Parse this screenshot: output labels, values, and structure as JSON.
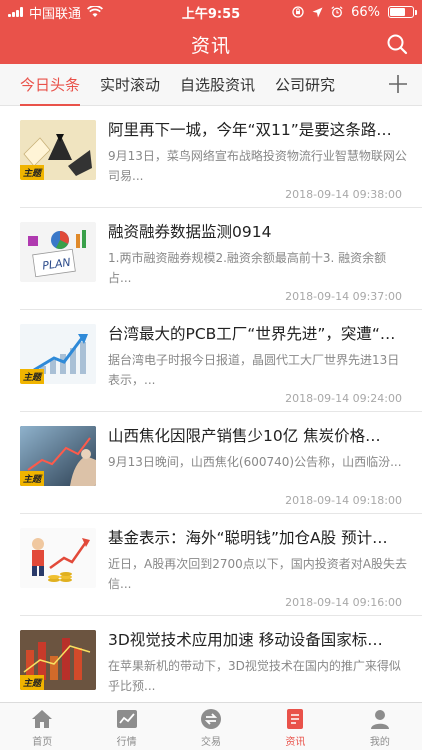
{
  "status_bar": {
    "carrier": "中国联通",
    "time": "上午9:55",
    "battery": "66%",
    "battery_level": 0.66
  },
  "header": {
    "title": "资讯"
  },
  "tabs": [
    {
      "label": "今日头条",
      "active": true
    },
    {
      "label": "实时滚动",
      "active": false
    },
    {
      "label": "自选股资讯",
      "active": false
    },
    {
      "label": "公司研究",
      "active": false
    }
  ],
  "news": [
    {
      "title": "阿里再下一城，今年“双11”是要这条路…",
      "summary": "9月13日，菜鸟网络宣布战略投资物流行业智慧物联网公司易...",
      "time": "2018-09-14 09:38:00",
      "tag": "主题"
    },
    {
      "title": "融资融券数据监测0914",
      "summary": "1.两市融资融券规模2.融资余额最高前十3. 融资余额占...",
      "time": "2018-09-14 09:37:00",
      "tag": ""
    },
    {
      "title": "台湾最大的PCB工厂“世界先进”，突遭“…",
      "summary": "据台湾电子时报今日报道，晶圆代工大厂世界先进13日表示，...",
      "time": "2018-09-14 09:24:00",
      "tag": "主题"
    },
    {
      "title": "山西焦化因限产销售少10亿 焦炭价格…",
      "summary": "9月13日晚间，山西焦化(600740)公告称，山西临汾...",
      "time": "2018-09-14 09:18:00",
      "tag": "主题"
    },
    {
      "title": "基金表示：海外“聪明钱”加仓A股 预计…",
      "summary": "近日，A股再次回到2700点以下，国内投资者对A股失去信...",
      "time": "2018-09-14 09:16:00",
      "tag": ""
    },
    {
      "title": "3D视觉技术应用加速 移动设备国家标…",
      "summary": "在苹果新机的带动下，3D视觉技术在国内的推广来得似乎比预...",
      "time": "",
      "tag": "主题"
    }
  ],
  "tabbar": [
    {
      "label": "首页",
      "icon": "home-icon",
      "active": false
    },
    {
      "label": "行情",
      "icon": "chart-icon",
      "active": false
    },
    {
      "label": "交易",
      "icon": "exchange-icon",
      "active": false
    },
    {
      "label": "资讯",
      "icon": "news-icon",
      "active": true
    },
    {
      "label": "我的",
      "icon": "profile-icon",
      "active": false
    }
  ],
  "colors": {
    "brand": "#e9524a",
    "tag": "#f0b400"
  }
}
